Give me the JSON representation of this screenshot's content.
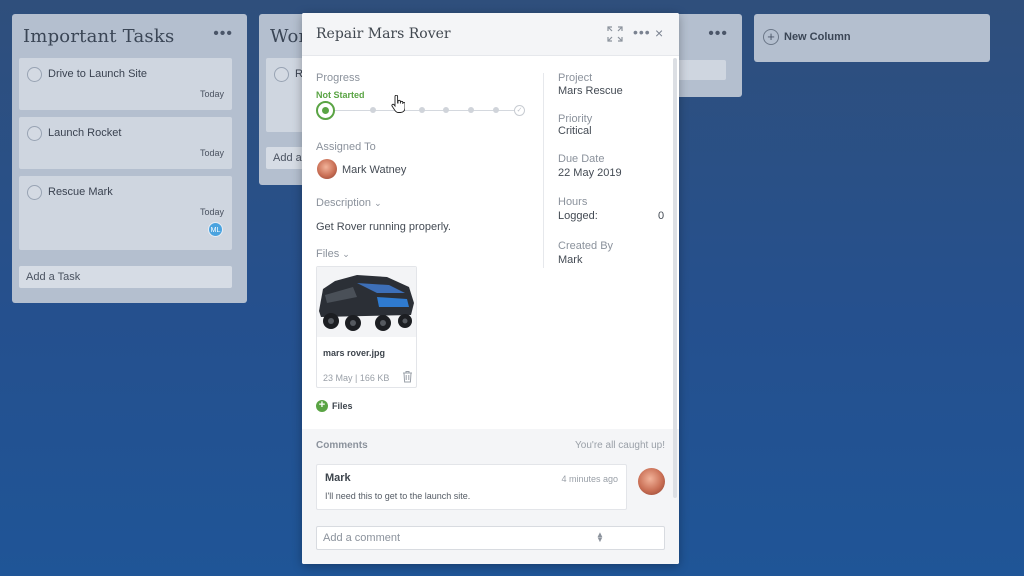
{
  "board": {
    "columns": [
      {
        "title": "Important Tasks",
        "menu": "•••",
        "cards": [
          {
            "title": "Drive to Launch Site",
            "date": "Today"
          },
          {
            "title": "Launch Rocket",
            "date": "Today"
          },
          {
            "title": "Rescue Mark",
            "date": "Today",
            "avatar": "ML"
          }
        ],
        "add_task": "Add a Task"
      },
      {
        "title": "Wor",
        "card_initial": "R",
        "add_task": "Add a"
      },
      {
        "menu": "•••"
      }
    ],
    "new_column": "New Column"
  },
  "modal": {
    "title": "Repair Mars Rover",
    "more": "•••",
    "close": "×",
    "progress": {
      "label": "Progress",
      "status": "Not Started",
      "status_color": "#5aa444"
    },
    "assigned": {
      "label": "Assigned To",
      "name": "Mark Watney"
    },
    "description": {
      "label": "Description",
      "text": "Get Rover running properly."
    },
    "files": {
      "label": "Files",
      "items": [
        {
          "name": "mars rover.jpg",
          "meta": "23 May | 166 KB"
        }
      ],
      "add_label": "Files"
    },
    "details": {
      "project_label": "Project",
      "project": "Mars Rescue",
      "priority_label": "Priority",
      "priority": "Critical",
      "due_label": "Due Date",
      "due": "22 May 2019",
      "hours_label": "Hours",
      "logged_label": "Logged:",
      "logged": "0",
      "created_label": "Created By",
      "created": "Mark"
    },
    "comments": {
      "label": "Comments",
      "caught_up": "You're all caught up!",
      "items": [
        {
          "author": "Mark",
          "time": "4 minutes ago",
          "text": "I'll need this to get to the launch site."
        }
      ],
      "placeholder": "Add a comment"
    }
  }
}
